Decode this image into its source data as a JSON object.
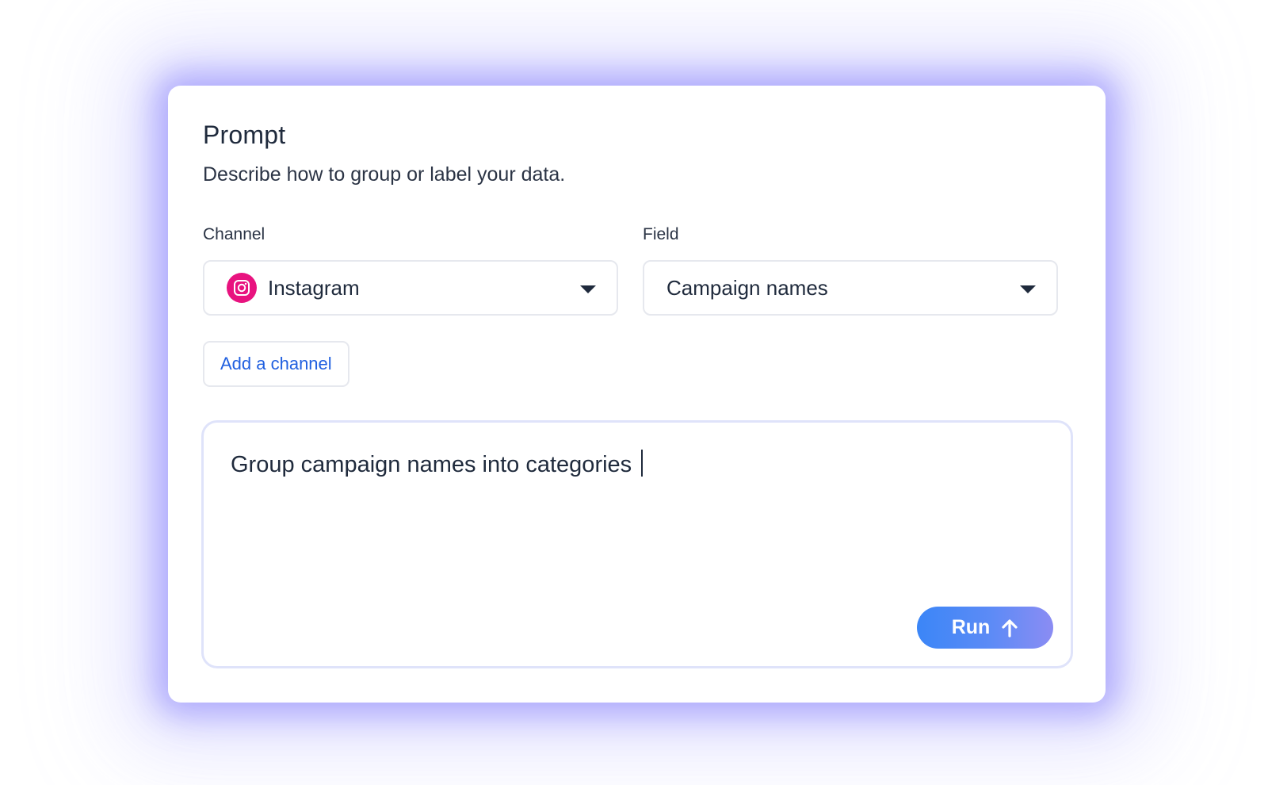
{
  "panel": {
    "title": "Prompt",
    "subtitle": "Describe how to group or label your data."
  },
  "channel": {
    "label": "Channel",
    "selected": "Instagram",
    "icon": "instagram-icon",
    "icon_color": "#e8137f"
  },
  "field": {
    "label": "Field",
    "selected": "Campaign names"
  },
  "add_channel": {
    "label": "Add a channel"
  },
  "prompt": {
    "text": "Group campaign names into categories"
  },
  "run_button": {
    "label": "Run",
    "icon": "arrow-up-icon"
  },
  "colors": {
    "accent": "#2160e0",
    "run_gradient_start": "#3b86f7",
    "run_gradient_end": "#8b8cf3",
    "glow": "#8078fa"
  }
}
